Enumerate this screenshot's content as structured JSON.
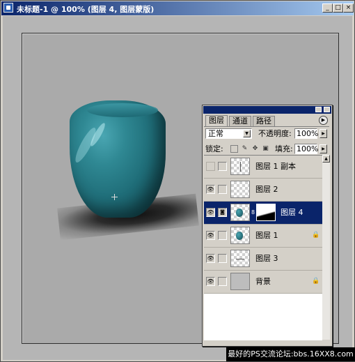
{
  "window": {
    "title": "未标题-1 @ 100% (图层 4, 图层蒙版)",
    "buttons": {
      "minimize": "_",
      "maximize": "□",
      "close": "×"
    }
  },
  "layers_panel": {
    "tabs": [
      {
        "label": "图层",
        "active": true
      },
      {
        "label": "通道",
        "active": false
      },
      {
        "label": "路径",
        "active": false
      }
    ],
    "blend_mode": "正常",
    "opacity_label": "不透明度:",
    "opacity_value": "100%",
    "lock_label": "锁定:",
    "fill_label": "填充:",
    "fill_value": "100%",
    "layers": [
      {
        "name": "图层 1 副本",
        "visible": false,
        "selected": false,
        "thumb": "line-icon",
        "locked": false
      },
      {
        "name": "图层 2",
        "visible": true,
        "selected": false,
        "thumb": "transparent",
        "locked": false
      },
      {
        "name": "图层 4",
        "visible": true,
        "selected": true,
        "thumb": "vase-icon",
        "has_mask": true,
        "locked": false
      },
      {
        "name": "图层 1",
        "visible": true,
        "selected": false,
        "thumb": "vase-icon",
        "locked": true
      },
      {
        "name": "图层 3",
        "visible": true,
        "selected": false,
        "thumb": "dash-icon",
        "locked": false
      },
      {
        "name": "背景",
        "visible": true,
        "selected": false,
        "thumb": "gray",
        "locked": true
      }
    ]
  },
  "watermark": "最好的PS交流论坛:bbs.16XX8.com",
  "colors": {
    "titlebar_start": "#0a246a",
    "titlebar_end": "#a6caf0",
    "vase": "#1f6d78",
    "selection": "#0a246a"
  }
}
